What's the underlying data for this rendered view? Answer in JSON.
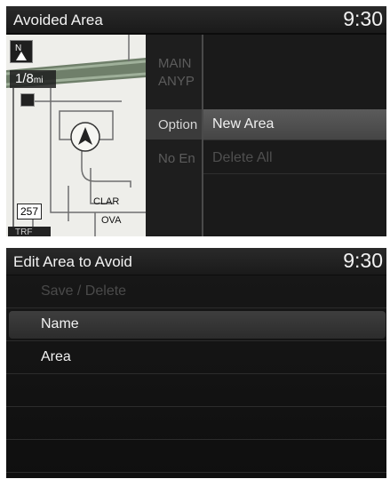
{
  "screen1": {
    "title": "Avoided Area",
    "clock": "9:30",
    "map": {
      "scale_value": "1/8",
      "scale_unit": "mi",
      "streets": [
        "CLAR",
        "OVA"
      ],
      "route_number": "257",
      "traffic_label": "TRF",
      "icons": [
        "north-up-icon",
        "position-arrow-icon",
        "poi-icon",
        "traffic-icon"
      ]
    },
    "left_menu": {
      "items": [
        "MAIN",
        "ANYP",
        "Option",
        "No En"
      ]
    },
    "right_menu": {
      "items": [
        "New Area",
        "Delete All"
      ]
    }
  },
  "screen2": {
    "title": "Edit Area to Avoid",
    "clock": "9:30",
    "items": [
      "Save / Delete",
      "Name",
      "Area"
    ]
  }
}
